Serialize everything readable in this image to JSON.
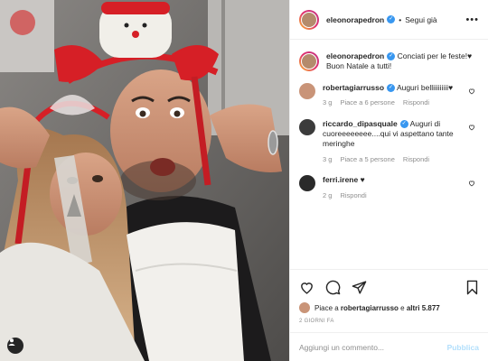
{
  "post": {
    "image_alt": "Foto di eleonorapedron"
  },
  "header": {
    "username": "eleonorapedron",
    "separator": "•",
    "follow_label": "Segui già",
    "more_label": "•••"
  },
  "caption": {
    "username": "eleonorapedron",
    "text_line1": "Conciati per le feste!♥",
    "text_line2": "Buon Natale a tutti!"
  },
  "comments": [
    {
      "username": "robertagiarrusso",
      "text": "Auguri belliiiiiiiii♥",
      "time": "3 g",
      "likes": "Piace a 6 persone",
      "reply": "Rispondi"
    },
    {
      "username": "riccardo_dipasquale",
      "text": "Auguri di cuoreeeeeeee....qui vi aspettano tante meringhe",
      "time": "3 g",
      "likes": "Piace a 5 persone",
      "reply": "Rispondi"
    },
    {
      "username": "ferri.irene",
      "text": "♥",
      "time": "2 g",
      "likes": "",
      "reply": "Rispondi"
    }
  ],
  "likes": {
    "prefix": "Piace a ",
    "user": "robertagiarrusso",
    "middle": " e ",
    "others": "altri 5.877"
  },
  "timestamp": "2 GIORNI FA",
  "add_comment": {
    "placeholder": "Aggiungi un commento...",
    "publish_label": "Pubblica"
  },
  "colors": {
    "verified": "#3897f0",
    "publish": "#b2dffc",
    "muted": "#8e8e8e",
    "text": "#262626"
  }
}
